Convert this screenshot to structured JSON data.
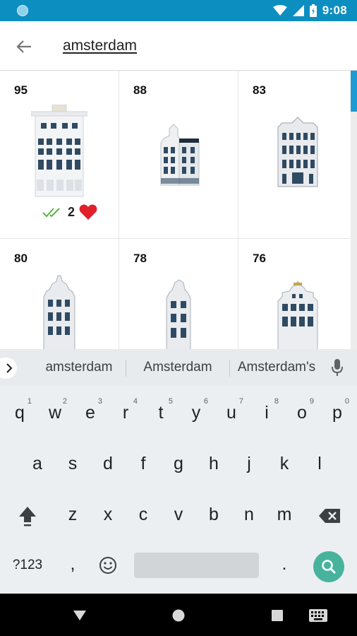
{
  "status_bar": {
    "time": "9:08"
  },
  "toolbar": {
    "search_query": "amsterdam"
  },
  "grid": {
    "items": [
      {
        "number": "95",
        "count": "2",
        "favorite": true,
        "owned": true
      },
      {
        "number": "88"
      },
      {
        "number": "83"
      },
      {
        "number": "80"
      },
      {
        "number": "78"
      },
      {
        "number": "76"
      }
    ]
  },
  "keyboard": {
    "suggestions": [
      "amsterdam",
      "Amsterdam",
      "Amsterdam's"
    ],
    "row1": [
      "q",
      "w",
      "e",
      "r",
      "t",
      "y",
      "u",
      "i",
      "o",
      "p"
    ],
    "row1_hints": [
      "1",
      "2",
      "3",
      "4",
      "5",
      "6",
      "7",
      "8",
      "9",
      "0"
    ],
    "row2": [
      "a",
      "s",
      "d",
      "f",
      "g",
      "h",
      "j",
      "k",
      "l"
    ],
    "row3": [
      "z",
      "x",
      "c",
      "v",
      "b",
      "n",
      "m"
    ],
    "symbols_label": "?123",
    "comma": ",",
    "period": "."
  },
  "colors": {
    "status_bar": "#0d8ec0",
    "accent": "#1e9ad4",
    "search_key": "#47b39d",
    "heart": "#e0202a",
    "check": "#5ab146"
  }
}
